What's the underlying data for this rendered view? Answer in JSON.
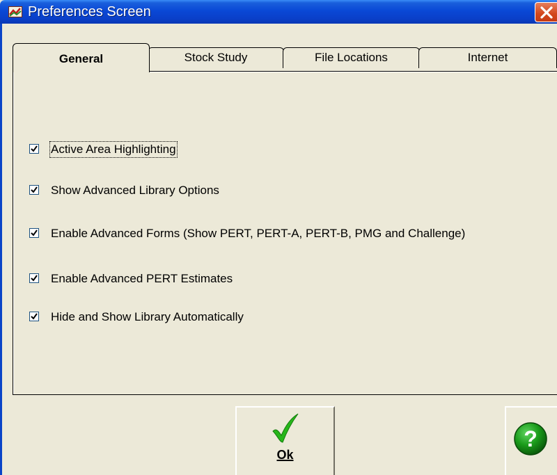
{
  "window": {
    "title": "Preferences Screen",
    "app_icon": "app-icon",
    "close_icon": "close-icon"
  },
  "tabs": [
    {
      "label": "General",
      "active": true
    },
    {
      "label": "Stock Study",
      "active": false
    },
    {
      "label": "File Locations",
      "active": false
    },
    {
      "label": "Internet",
      "active": false
    }
  ],
  "options": [
    {
      "label": "Active Area Highlighting",
      "checked": true
    },
    {
      "label": "Show Advanced Library Options",
      "checked": true
    },
    {
      "label": "Enable Advanced Forms (Show PERT, PERT-A, PERT-B, PMG and Challenge)",
      "checked": true
    },
    {
      "label": "Enable Advanced PERT Estimates",
      "checked": true
    },
    {
      "label": "Hide and Show Library Automatically",
      "checked": true
    }
  ],
  "buttons": {
    "ok_label": "Ok",
    "ok_icon": "checkmark-icon",
    "help_icon": "help-icon"
  },
  "colors": {
    "title_bar": "#0a48d6",
    "window_bg": "#ece9d8",
    "close_button": "#d2461c",
    "ok_check": "#27b61a",
    "help": "#1a8a1a"
  }
}
